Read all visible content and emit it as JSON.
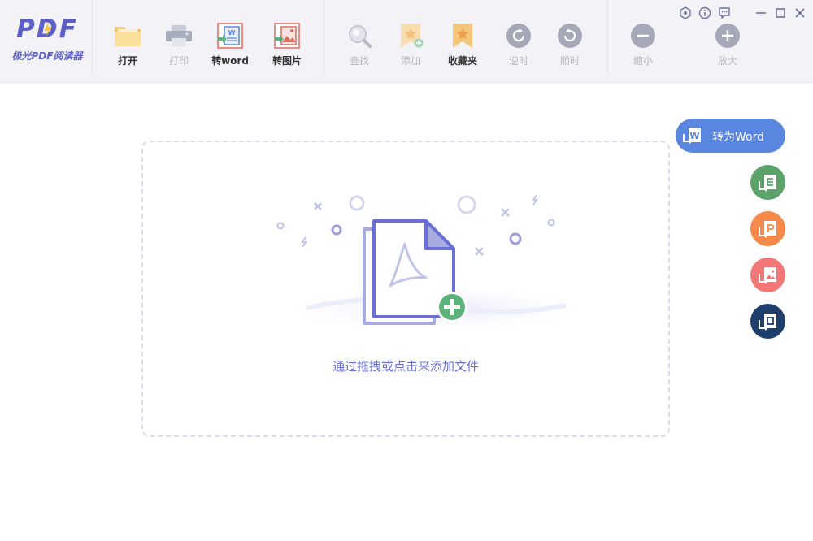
{
  "app": {
    "logo_text": "PDF",
    "logo_subtitle": "极光PDF阅读器"
  },
  "toolbar": {
    "open_label": "打开",
    "print_label": "打印",
    "to_word_label": "转word",
    "to_image_label": "转图片",
    "find_label": "查找",
    "add_label": "添加",
    "favorites_label": "收藏夹",
    "rotate_ccw_label": "逆时",
    "rotate_cw_label": "顺时",
    "zoom_out_label": "缩小",
    "zoom_in_label": "放大"
  },
  "dropzone": {
    "prompt": "通过拖拽或点击来添加文件"
  },
  "converters": {
    "word_label": "转为Word"
  },
  "colors": {
    "accent": "#6a6fd6",
    "word_blue": "#5b86e0",
    "excel_green": "#5ba36b",
    "ppt_orange": "#f58a4b",
    "image_red": "#f27878",
    "cad_navy": "#1e3f6b",
    "add_green": "#5cb27a"
  }
}
